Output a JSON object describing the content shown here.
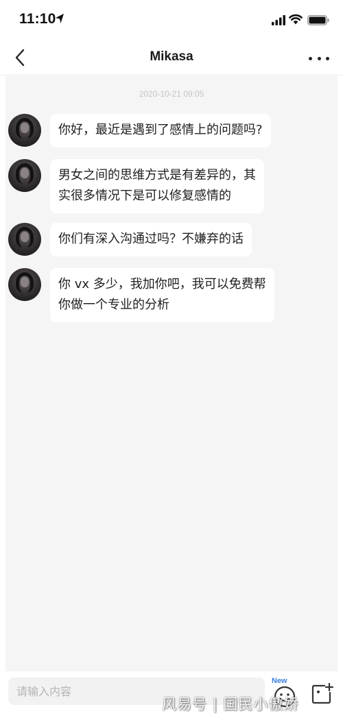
{
  "status_bar": {
    "time": "11:10",
    "icons": [
      "location-arrow-icon",
      "cellular-signal-icon",
      "wifi-icon",
      "battery-icon"
    ]
  },
  "nav": {
    "title": "Mikasa",
    "back_icon": "chevron-left-icon",
    "more_icon": "more-dots-icon"
  },
  "chat": {
    "timestamp": "2020-10-21 09:05",
    "messages": [
      {
        "sender": "Mikasa",
        "lines": [
          "你好，最近是遇到了感情上的问题吗?"
        ]
      },
      {
        "sender": "Mikasa",
        "lines": [
          "男女之间的思维方式是有差异的，其",
          "实很多情况下是可以修复感情的"
        ]
      },
      {
        "sender": "Mikasa",
        "lines": [
          "你们有深入沟通过吗？不嫌弃的话"
        ]
      },
      {
        "sender": "Mikasa",
        "lines": [
          "你 vx 多少，我加你吧，我可以免费帮",
          "你做一个专业的分析"
        ]
      }
    ]
  },
  "input": {
    "placeholder": "请输入内容",
    "new_badge": "New",
    "emoji_icon": "emoji-face-icon",
    "add_icon": "add-image-icon"
  },
  "watermark": "风易号 | 国民小傲娇",
  "colors": {
    "chat_background": "#f5f5f5",
    "bubble": "#ffffff",
    "accent_new": "#3d7fe0"
  }
}
